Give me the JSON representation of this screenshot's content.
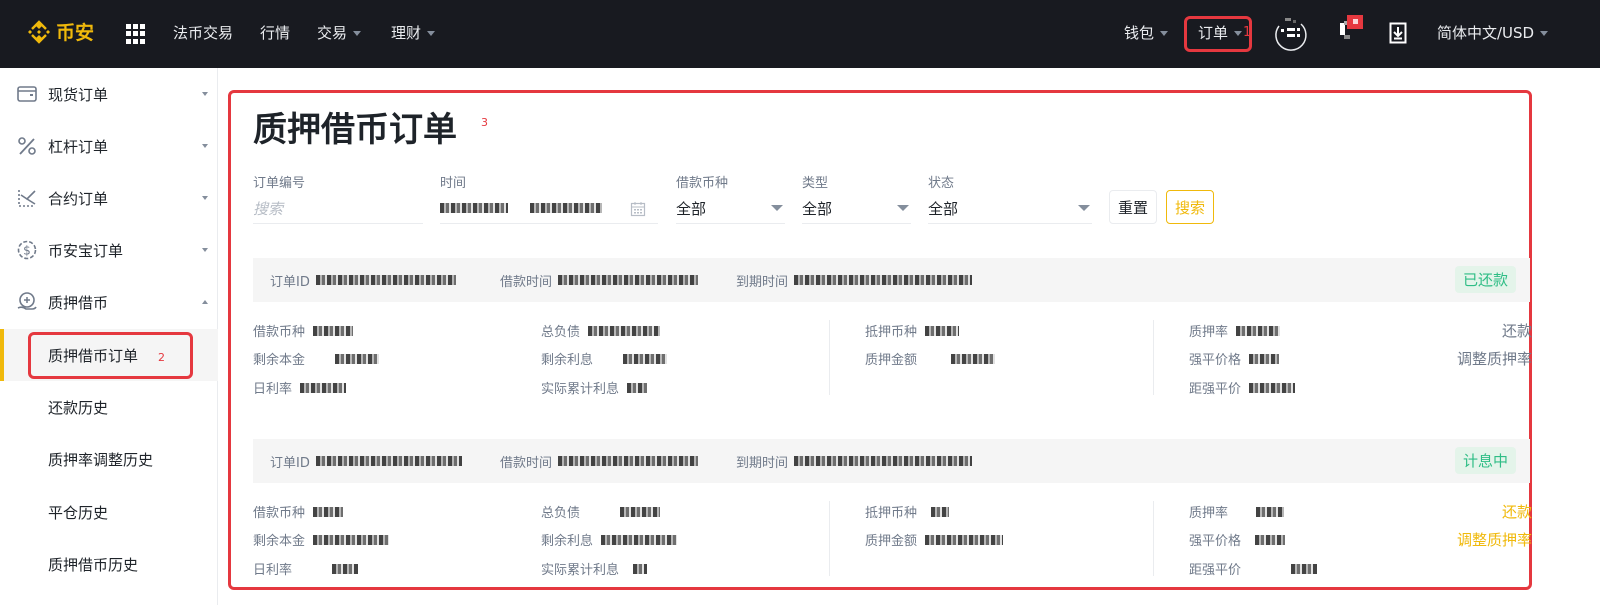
{
  "header": {
    "logo_text": "币安",
    "nav": [
      {
        "label": "法币交易",
        "has_caret": false
      },
      {
        "label": "行情",
        "has_caret": false
      },
      {
        "label": "交易",
        "has_caret": true
      },
      {
        "label": "理财",
        "has_caret": true
      }
    ],
    "right": {
      "wallet": "钱包",
      "orders": "订单",
      "orders_mark": "1",
      "language": "简体中文/USD"
    }
  },
  "sidebar": {
    "items": [
      {
        "label": "现货订单",
        "icon": "wallet-icon",
        "expanded": false
      },
      {
        "label": "杠杆订单",
        "icon": "percent-icon",
        "expanded": false
      },
      {
        "label": "合约订单",
        "icon": "futures-icon",
        "expanded": false
      },
      {
        "label": "币安宝订单",
        "icon": "dollar-coin-icon",
        "expanded": false
      },
      {
        "label": "质押借币",
        "icon": "loan-icon",
        "expanded": true
      }
    ],
    "sub_items": [
      {
        "label": "质押借币订单",
        "active": true,
        "mark": "2"
      },
      {
        "label": "还款历史",
        "active": false
      },
      {
        "label": "质押率调整历史",
        "active": false
      },
      {
        "label": "平仓历史",
        "active": false
      },
      {
        "label": "质押借币历史",
        "active": false
      }
    ]
  },
  "main": {
    "title": "质押借币订单",
    "title_mark": "3",
    "filters": {
      "order_no_label": "订单编号",
      "order_no_placeholder": "搜索",
      "time_label": "时间",
      "coin_label": "借款币种",
      "coin_value": "全部",
      "type_label": "类型",
      "type_value": "全部",
      "status_label": "状态",
      "status_value": "全部",
      "reset": "重置",
      "search": "搜索"
    },
    "orders": [
      {
        "order_id_label": "订单ID",
        "borrow_time_label": "借款时间",
        "expire_time_label": "到期时间",
        "status": "已还款",
        "loan_coin_label": "借款币种",
        "remaining_principal_label": "剩余本金",
        "daily_rate_label": "日利率",
        "total_debt_label": "总负债",
        "remaining_interest_label": "剩余利息",
        "accrued_interest_label": "实际累计利息",
        "collateral_coin_label": "抵押币种",
        "collateral_amount_label": "质押金额",
        "ltv_label": "质押率",
        "liq_price_label": "强平价格",
        "to_liq_label": "距强平价",
        "repay": "还款",
        "adjust_ltv": "调整质押率",
        "actions_enabled": false
      },
      {
        "order_id_label": "订单ID",
        "borrow_time_label": "借款时间",
        "expire_time_label": "到期时间",
        "status": "计息中",
        "loan_coin_label": "借款币种",
        "remaining_principal_label": "剩余本金",
        "daily_rate_label": "日利率",
        "total_debt_label": "总负债",
        "remaining_interest_label": "剩余利息",
        "accrued_interest_label": "实际累计利息",
        "collateral_coin_label": "抵押币种",
        "collateral_amount_label": "质押金额",
        "ltv_label": "质押率",
        "liq_price_label": "强平价格",
        "to_liq_label": "距强平价",
        "repay": "还款",
        "adjust_ltv": "调整质押率",
        "actions_enabled": true
      }
    ]
  },
  "colors": {
    "brand": "#f0b90b",
    "highlight": "#e5383f",
    "status_green": "#2ebd85"
  }
}
